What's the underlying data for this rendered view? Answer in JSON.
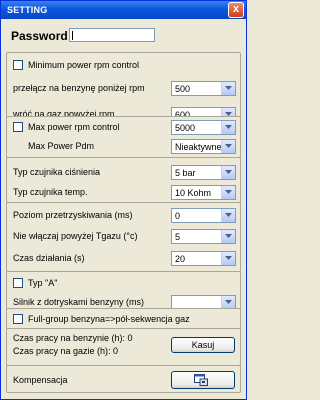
{
  "window": {
    "title": "SETTING",
    "close_glyph": "x"
  },
  "password": {
    "label": "Password",
    "value": ""
  },
  "group1": {
    "min_rpm_control": {
      "label": "Minimum power rpm control",
      "checked": false
    },
    "switch_below": {
      "label": "przełącz na benzynę poniżej rpm",
      "value": "500"
    },
    "return_above": {
      "label": "wróć na gaz powyżej rpm",
      "value": "600"
    }
  },
  "group2": {
    "max_rpm_control": {
      "label": "Max power rpm control",
      "checked": false,
      "value": "5000"
    },
    "max_power_pdm": {
      "label": "Max Power Pdm",
      "value": "Nieaktywne"
    }
  },
  "group3": {
    "pressure_sensor": {
      "label": "Typ czujnika ciśnienia",
      "value": "5 bar"
    },
    "temp_sensor": {
      "label": "Typ czujnika temp.",
      "value": "10 Kohm"
    }
  },
  "group4": {
    "overinjection": {
      "label": "Poziom przetrzyskiwania (ms)",
      "value": "0"
    },
    "gas_temp_min": {
      "label": "Nie włączaj powyżej Tgazu (°c)",
      "value": "5"
    },
    "action_time": {
      "label": "Czas działania (s)",
      "value": "20"
    }
  },
  "group5": {
    "type_a": {
      "label": "Typ \"A\"",
      "checked": false
    },
    "petrol_engine": {
      "label": "Silnik z dotryskami benzyny (ms)",
      "value": ""
    }
  },
  "group6": {
    "full_group": {
      "label": "Full-group benzyna=>pół-sekwencja gaz",
      "checked": false
    }
  },
  "group7": {
    "petrol_time": {
      "label": "Czas pracy na benzynie (h): 0"
    },
    "gas_time": {
      "label": "Czas pracy na gazie (h): 0"
    },
    "reset_button": {
      "label": "Kasuj"
    }
  },
  "group8": {
    "compensation": {
      "label": "Kompensacja"
    },
    "compensation_button_icon": "window-settings-icon"
  },
  "colors": {
    "title_bar": "#0a58dc",
    "window_bg": "#ece9d8",
    "border": "#7f9db9"
  }
}
